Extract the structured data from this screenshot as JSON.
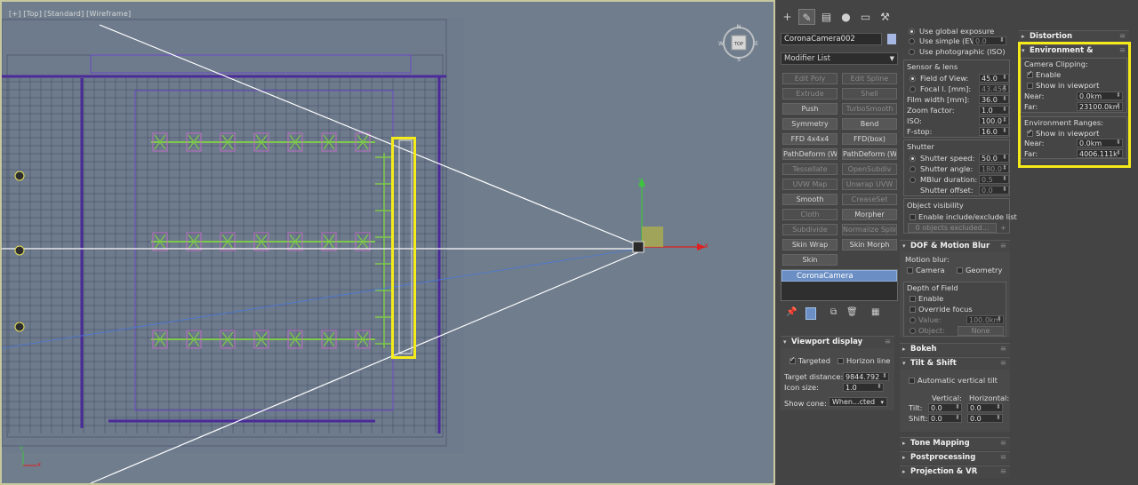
{
  "viewport": {
    "label": "[+] [Top] [Standard] [Wireframe]",
    "viewcube_label": "TOP",
    "viewcube_n": "N",
    "viewcube_s": "S",
    "viewcube_w": "W",
    "viewcube_e": "E",
    "axis_y": "y",
    "axis_x": "x",
    "corner_y": "y",
    "corner_x": "x",
    "accent": "#7ec94a"
  },
  "toolbar": {
    "icons": [
      "create-icon",
      "modify-icon",
      "hierarchy-icon",
      "motion-icon",
      "display-icon",
      "utilities-icon"
    ],
    "glyphs": [
      "+",
      "✎",
      "▤",
      "●",
      "▭",
      "🔧"
    ]
  },
  "object_name": "CoronaCamera002",
  "modifier_list": "Modifier List",
  "modifiers": [
    {
      "label": "Edit Poly",
      "dim": true
    },
    {
      "label": "Edit Spline",
      "dim": true
    },
    {
      "label": "Extrude",
      "dim": true
    },
    {
      "label": "Shell",
      "dim": true
    },
    {
      "label": "Push",
      "dim": false
    },
    {
      "label": "TurboSmooth",
      "dim": true
    },
    {
      "label": "Symmetry",
      "dim": false
    },
    {
      "label": "Bend",
      "dim": false
    },
    {
      "label": "FFD 4x4x4",
      "dim": false
    },
    {
      "label": "FFD(box)",
      "dim": false
    },
    {
      "label": "PathDeform (WSM)",
      "dim": false
    },
    {
      "label": "PathDeform (WSM)",
      "dim": false
    },
    {
      "label": "Tessellate",
      "dim": true
    },
    {
      "label": "OpenSubdiv",
      "dim": true
    },
    {
      "label": "UVW Map",
      "dim": true
    },
    {
      "label": "Unwrap UVW",
      "dim": true
    },
    {
      "label": "Smooth",
      "dim": false
    },
    {
      "label": "CreaseSet",
      "dim": true
    },
    {
      "label": "Cloth",
      "dim": true
    },
    {
      "label": "Morpher",
      "dim": false
    },
    {
      "label": "Subdivide",
      "dim": true
    },
    {
      "label": "Normalize Spline",
      "dim": true
    },
    {
      "label": "Skin Wrap",
      "dim": false
    },
    {
      "label": "Skin Morph",
      "dim": false
    },
    {
      "label": "Skin",
      "dim": false
    }
  ],
  "stack_item": "CoronaCamera",
  "viewport_display": {
    "title": "Viewport display",
    "targeted": "Targeted",
    "horizon_line": "Horizon line",
    "target_distance_label": "Target distance:",
    "target_distance": "9844.792",
    "icon_size_label": "Icon size:",
    "icon_size": "1.0",
    "show_cone_label": "Show cone:",
    "show_cone": "When...cted"
  },
  "exposure": {
    "use_global": "Use global exposure",
    "use_simple": "Use simple (EV)",
    "simple_val": "0.0",
    "use_photo": "Use photographic (ISO)"
  },
  "sensor": {
    "title": "Sensor & lens",
    "fov_label": "Field of View:",
    "fov": "45.0",
    "focal_label": "Focal l. [mm]:",
    "focal": "43.456",
    "film_label": "Film width [mm]:",
    "film": "36.0",
    "zoom_label": "Zoom factor:",
    "zoom": "1.0",
    "iso_label": "ISO:",
    "iso": "100.0",
    "fstop_label": "F-stop:",
    "fstop": "16.0"
  },
  "shutter": {
    "title": "Shutter",
    "speed_label": "Shutter speed:",
    "speed": "50.0",
    "angle_label": "Shutter angle:",
    "angle": "180.0",
    "mblur_label": "MBlur duration:",
    "mblur": "0.5",
    "offset_label": "Shutter offset:",
    "offset": "0.0"
  },
  "object_visibility": {
    "title": "Object visibility",
    "enable": "Enable include/exclude list",
    "excluded": "0 objects excluded...",
    "plus": "+"
  },
  "dof": {
    "title": "DOF & Motion Blur",
    "motion_blur": "Motion blur:",
    "camera": "Camera",
    "geometry": "Geometry",
    "depth_title": "Depth of Field",
    "enable": "Enable",
    "override": "Override focus",
    "value_label": "Value:",
    "value": "100.0km",
    "object_label": "Object:",
    "object": "None"
  },
  "bokeh": "Bokeh",
  "tilt": {
    "title": "Tilt & Shift",
    "auto": "Automatic vertical tilt",
    "vertical": "Vertical:",
    "horizontal": "Horizontal:",
    "tilt_label": "Tilt:",
    "shift_label": "Shift:",
    "tilt_v": "0.0",
    "tilt_h": "0.0",
    "shift_v": "0.0",
    "shift_h": "0.0"
  },
  "tone_mapping": "Tone Mapping",
  "postprocessing": "Postprocessing",
  "projection": "Projection & VR",
  "distortion": "Distortion",
  "env_clip": {
    "title": "Environment & Clipping",
    "camera_clipping": "Camera Clipping:",
    "enable": "Enable",
    "show_vp": "Show in viewport",
    "near_label": "Near:",
    "near": "0.0km",
    "far_label": "Far:",
    "far": "23100.0km",
    "env_ranges": "Environment Ranges:",
    "show_vp2": "Show in viewport",
    "near2_label": "Near:",
    "near2": "0.0km",
    "far2_label": "Far:",
    "far2": "4006.111k",
    "highlight": "#f5ea1a"
  }
}
